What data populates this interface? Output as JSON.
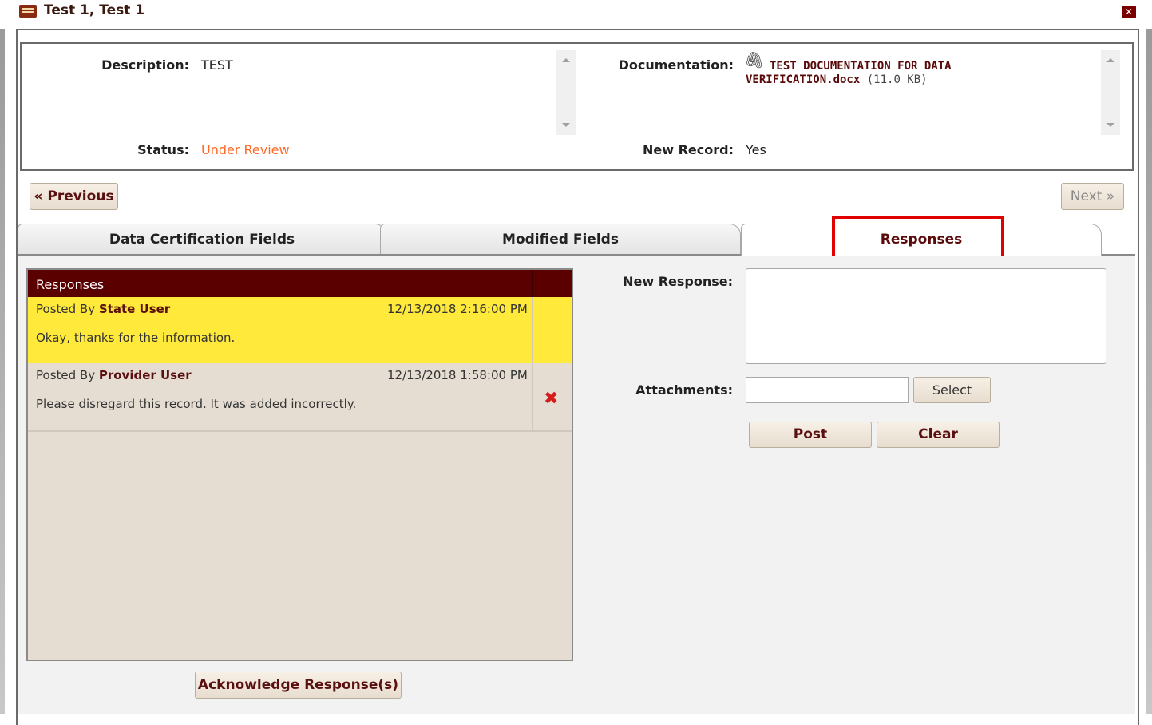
{
  "window": {
    "title": "Test 1, Test 1",
    "close_glyph": "✕"
  },
  "record": {
    "description_label": "Description:",
    "description_value": "TEST",
    "status_label": "Status:",
    "status_value": "Under Review",
    "status_color": "#ff6a28",
    "documentation_label": "Documentation:",
    "doc_name_line1": "TEST DOCUMENTATION FOR DATA",
    "doc_name_line2": "VERIFICATION.docx",
    "doc_size": "(11.0 KB)",
    "new_record_label": "New Record:",
    "new_record_value": "Yes"
  },
  "nav": {
    "previous": "« Previous",
    "next": "Next »"
  },
  "tabs": [
    {
      "label": "Data Certification Fields"
    },
    {
      "label": "Modified Fields"
    },
    {
      "label": "Responses",
      "active": true
    }
  ],
  "responses": {
    "header": "Responses",
    "items": [
      {
        "posted_by_prefix": "Posted By",
        "author": "State User",
        "timestamp": "12/13/2018 2:16:00 PM",
        "message": "Okay, thanks for the information.",
        "highlighted": true,
        "row_color": "#ffe93a"
      },
      {
        "posted_by_prefix": "Posted By",
        "author": "Provider User",
        "timestamp": "12/13/2018 1:58:00 PM",
        "message": "Please disregard this record. It was added incorrectly.",
        "highlighted": false,
        "deletable": true,
        "row_color": "#e6ddd2"
      }
    ],
    "acknowledge_button": "Acknowledge Response(s)"
  },
  "new_response": {
    "label": "New Response:",
    "value": "",
    "attachments_label": "Attachments:",
    "attachments_value": "",
    "select_button": "Select",
    "post_button": "Post",
    "clear_button": "Clear"
  },
  "colors": {
    "accent": "#5a0000",
    "highlight_border": "#e00000"
  }
}
